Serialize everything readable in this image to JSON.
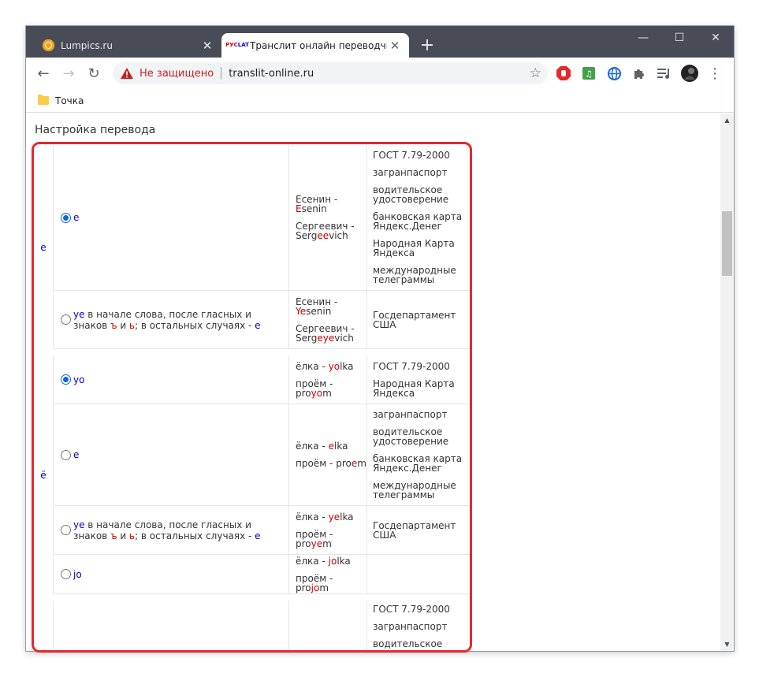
{
  "browser": {
    "tabs": [
      {
        "title": "Lumpics.ru",
        "close": "✕"
      },
      {
        "title": "Транслит онлайн переводчик",
        "close": "✕",
        "favicon_top": "РУС",
        "favicon_bottom": "LAT"
      }
    ],
    "new_tab": "+",
    "window_controls": {
      "minimize": "—",
      "maximize": "☐",
      "close": "✕"
    },
    "nav": {
      "back": "←",
      "forward": "→",
      "reload": "↻"
    },
    "address": {
      "security": "Не защищено",
      "url": "translit-online.ru",
      "star": "☆"
    },
    "bookmarks": [
      {
        "label": "Точка"
      }
    ],
    "extensions": [
      {
        "icon": "adblock-icon",
        "color": "#e32929"
      },
      {
        "icon": "music-icon",
        "color": "#43a047"
      },
      {
        "icon": "globe-icon",
        "color": "#1a66d9"
      },
      {
        "icon": "puzzle-icon",
        "color": "#5f6368"
      },
      {
        "icon": "media-icon",
        "color": "#5f6368"
      },
      {
        "icon": "avatar-icon",
        "color": "#333333"
      }
    ],
    "menu": "⋮"
  },
  "page": {
    "section_title": "Настройка перевода",
    "groups": [
      {
        "letter": "е",
        "rows": [
          {
            "checked": true,
            "option": "e",
            "examples": [
              {
                "pre": "Есенин - ",
                "hl": "E",
                "post": "senin"
              },
              {
                "pre": "Сергеевич - Serg",
                "hl": "ee",
                "post": "vich"
              }
            ],
            "standards": [
              "ГОСТ 7.79-2000",
              "загранпаспорт",
              "водительское удостоверение",
              "банковская карта Яндекс.Денег",
              "Народная Карта Яндекса",
              "международные телеграммы"
            ]
          },
          {
            "checked": false,
            "option_parts": [
              "ye",
              " в начале слова, после гласных и знаков ",
              "ъ",
              " и ",
              "ь",
              "; в остальных случаях - ",
              "e"
            ],
            "examples": [
              {
                "pre": "Есенин - ",
                "hl": "Ye",
                "post": "senin"
              },
              {
                "pre": "Сергеевич - Serg",
                "hl": "eye",
                "post": "vich"
              }
            ],
            "standards": [
              "Госдепартамент США"
            ]
          }
        ]
      },
      {
        "letter": "ё",
        "rows": [
          {
            "checked": true,
            "option": "yo",
            "examples": [
              {
                "pre": "ёлка - ",
                "hl": "yo",
                "post": "lka"
              },
              {
                "pre": "проём - pro",
                "hl": "yo",
                "post": "m"
              }
            ],
            "standards": [
              "ГОСТ 7.79-2000",
              "Народная Карта Яндекса"
            ]
          },
          {
            "checked": false,
            "option": "e",
            "examples": [
              {
                "pre": "ёлка - ",
                "hl": "e",
                "post": "lka"
              },
              {
                "pre": "проём - pro",
                "hl": "e",
                "post": "m"
              }
            ],
            "standards": [
              "загранпаспорт",
              "водительское удостоверение",
              "банковская карта Яндекс.Денег",
              "международные телеграммы"
            ]
          },
          {
            "checked": false,
            "option_parts": [
              "ye",
              " в начале слова, после гласных и знаков ",
              "ъ",
              " и ",
              "ь",
              "; в остальных случаях - ",
              "e"
            ],
            "examples": [
              {
                "pre": "ёлка - ",
                "hl": "ye",
                "post": "lka"
              },
              {
                "pre": "проём - pro",
                "hl": "ye",
                "post": "m"
              }
            ],
            "standards": [
              "Госдепартамент США"
            ]
          },
          {
            "checked": false,
            "option": "jo",
            "examples": [
              {
                "pre": "ёлка - ",
                "hl": "jo",
                "post": "lka"
              },
              {
                "pre": "проём - pro",
                "hl": "jo",
                "post": "m"
              }
            ],
            "standards": []
          }
        ]
      },
      {
        "letter": "",
        "rows": [
          {
            "checked": false,
            "option": "",
            "examples": [],
            "standards": [
              "ГОСТ 7.79-2000",
              "загранпаспорт",
              "водительское"
            ]
          }
        ]
      }
    ]
  },
  "colors": {
    "highlight_border": "#e5282f",
    "link_blue": "#0000cc",
    "accent_red": "#cc0000",
    "tabstrip": "#484c56"
  }
}
